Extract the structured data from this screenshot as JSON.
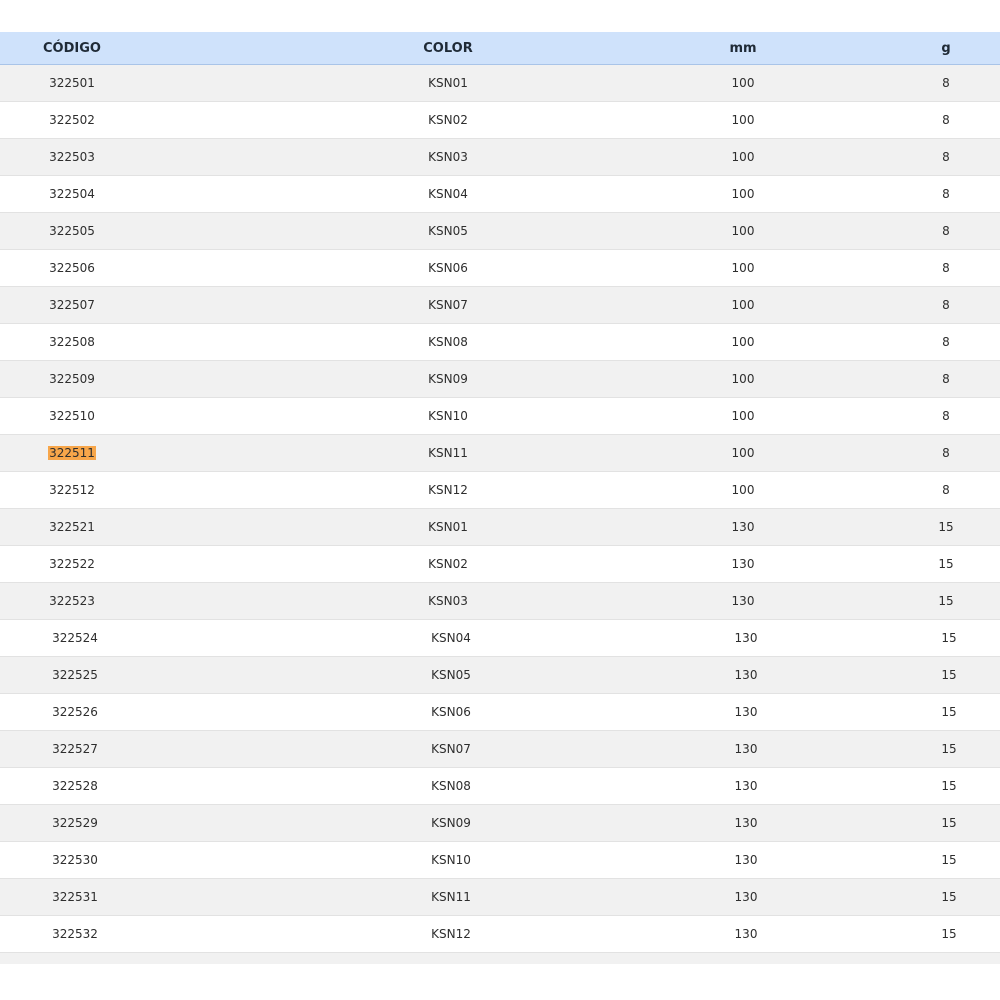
{
  "table": {
    "headers": {
      "code": "CÓDIGO",
      "color": "COLOR",
      "mm": "mm",
      "g": "g"
    },
    "highlighted_code": "322511",
    "rows": [
      {
        "code": "322501",
        "color": "KSN01",
        "mm": "100",
        "g": "8"
      },
      {
        "code": "322502",
        "color": "KSN02",
        "mm": "100",
        "g": "8"
      },
      {
        "code": "322503",
        "color": "KSN03",
        "mm": "100",
        "g": "8"
      },
      {
        "code": "322504",
        "color": "KSN04",
        "mm": "100",
        "g": "8"
      },
      {
        "code": "322505",
        "color": "KSN05",
        "mm": "100",
        "g": "8"
      },
      {
        "code": "322506",
        "color": "KSN06",
        "mm": "100",
        "g": "8"
      },
      {
        "code": "322507",
        "color": "KSN07",
        "mm": "100",
        "g": "8"
      },
      {
        "code": "322508",
        "color": "KSN08",
        "mm": "100",
        "g": "8"
      },
      {
        "code": "322509",
        "color": "KSN09",
        "mm": "100",
        "g": "8"
      },
      {
        "code": "322510",
        "color": "KSN10",
        "mm": "100",
        "g": "8"
      },
      {
        "code": "322511",
        "color": "KSN11",
        "mm": "100",
        "g": "8"
      },
      {
        "code": "322512",
        "color": "KSN12",
        "mm": "100",
        "g": "8"
      },
      {
        "code": "322521",
        "color": "KSN01",
        "mm": "130",
        "g": "15"
      },
      {
        "code": "322522",
        "color": "KSN02",
        "mm": "130",
        "g": "15"
      },
      {
        "code": "322523",
        "color": "KSN03",
        "mm": "130",
        "g": "15"
      },
      {
        "code": "322524",
        "color": "KSN04",
        "mm": "130",
        "g": "15"
      },
      {
        "code": "322525",
        "color": "KSN05",
        "mm": "130",
        "g": "15"
      },
      {
        "code": "322526",
        "color": "KSN06",
        "mm": "130",
        "g": "15"
      },
      {
        "code": "322527",
        "color": "KSN07",
        "mm": "130",
        "g": "15"
      },
      {
        "code": "322528",
        "color": "KSN08",
        "mm": "130",
        "g": "15"
      },
      {
        "code": "322529",
        "color": "KSN09",
        "mm": "130",
        "g": "15"
      },
      {
        "code": "322530",
        "color": "KSN10",
        "mm": "130",
        "g": "15"
      },
      {
        "code": "322531",
        "color": "KSN11",
        "mm": "130",
        "g": "15"
      },
      {
        "code": "322532",
        "color": "KSN12",
        "mm": "130",
        "g": "15"
      }
    ]
  },
  "colors": {
    "header_bg": "#cfe2fb",
    "stripe_bg": "#f1f1f1",
    "highlight": "#f7a64a"
  }
}
